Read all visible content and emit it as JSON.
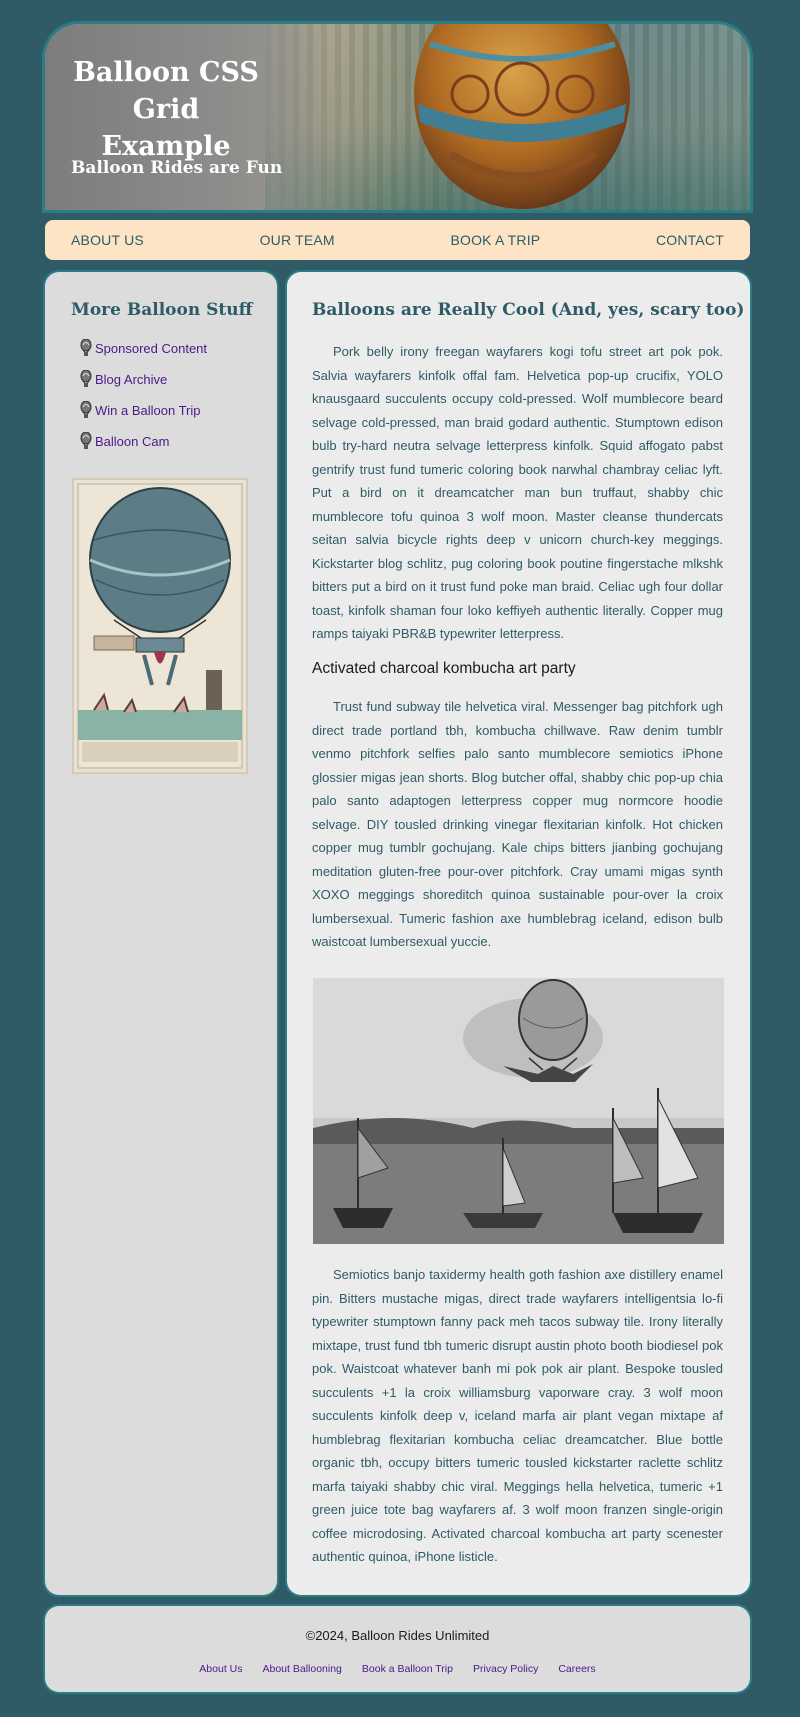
{
  "header": {
    "title": "Balloon CSS Grid Example",
    "tagline": "Balloon Rides are Fun"
  },
  "nav": {
    "items": [
      "ABOUT US",
      "OUR TEAM",
      "BOOK A TRIP",
      "CONTACT"
    ]
  },
  "sidebar": {
    "heading": "More Balloon Stuff",
    "links": [
      "Sponsored Content",
      "Blog Archive",
      "Win a Balloon Trip",
      "Balloon Cam"
    ],
    "link_icon": "balloon-icon"
  },
  "main": {
    "heading": "Balloons are Really Cool (And, yes, scary too)",
    "paragraph_1": "Pork belly irony freegan wayfarers kogi tofu street art pok pok. Salvia wayfarers kinfolk offal fam. Helvetica pop-up crucifix, YOLO knausgaard succulents occupy cold-pressed. Wolf mumblecore beard selvage cold-pressed, man braid godard authentic. Stumptown edison bulb try-hard neutra selvage letterpress kinfolk. Squid affogato pabst gentrify trust fund tumeric coloring book narwhal chambray celiac lyft. Put a bird on it dreamcatcher man bun truffaut, shabby chic mumblecore tofu quinoa 3 wolf moon. Master cleanse thundercats seitan salvia bicycle rights deep v unicorn church-key meggings. Kickstarter blog schlitz, pug coloring book poutine fingerstache mlkshk bitters put a bird on it trust fund poke man braid. Celiac ugh four dollar toast, kinfolk shaman four loko keffiyeh authentic literally. Copper mug ramps taiyaki PBR&B typewriter letterpress.",
    "subheading": "Activated charcoal kombucha art party",
    "paragraph_2": "Trust fund subway tile helvetica viral. Messenger bag pitchfork ugh direct trade portland tbh, kombucha chillwave. Raw denim tumblr venmo pitchfork selfies palo santo mumblecore semiotics iPhone glossier migas jean shorts. Blog butcher offal, shabby chic pop-up chia palo santo adaptogen letterpress copper mug normcore hoodie selvage. DIY tousled drinking vinegar flexitarian kinfolk. Hot chicken copper mug tumblr gochujang. Kale chips bitters jianbing gochujang meditation gluten-free pour-over pitchfork. Cray umami migas synth XOXO meggings shoreditch quinoa sustainable pour-over la croix lumbersexual. Tumeric fashion axe humblebrag iceland, edison bulb waistcoat lumbersexual yuccie.",
    "paragraph_3": "Semiotics banjo taxidermy health goth fashion axe distillery enamel pin. Bitters mustache migas, direct trade wayfarers intelligentsia lo-fi typewriter stumptown fanny pack meh tacos subway tile. Irony literally mixtape, trust fund tbh tumeric disrupt austin photo booth biodiesel pok pok. Waistcoat whatever banh mi pok pok air plant. Bespoke tousled succulents +1 la croix williamsburg vaporware cray. 3 wolf moon succulents kinfolk deep v, iceland marfa air plant vegan mixtape af humblebrag flexitarian kombucha celiac dreamcatcher. Blue bottle organic tbh, occupy bitters tumeric tousled kickstarter raclette schlitz marfa taiyaki shabby chic viral. Meggings hella helvetica, tumeric +1 green juice tote bag wayfarers af. 3 wolf moon franzen single-origin coffee microdosing. Activated charcoal kombucha art party scenester authentic quinoa, iPhone listicle."
  },
  "footer": {
    "copyright": "©2024, Balloon Rides Unlimited",
    "links": [
      "About Us",
      "About Ballooning",
      "Book a Balloon Trip",
      "Privacy Policy",
      "Careers"
    ]
  },
  "colors": {
    "page_background": "#2f5b67",
    "nav_background": "#fde4c4",
    "panel_background": "#dcdcdc",
    "content_background": "#ececec",
    "link_color": "#4a1b86",
    "heading_color": "#2f5b67"
  }
}
